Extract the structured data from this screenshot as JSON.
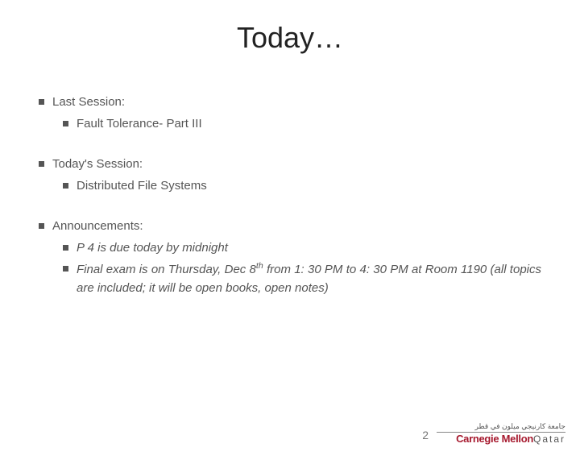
{
  "title": "Today…",
  "sections": [
    {
      "heading": "Last Session:",
      "items": [
        "Fault Tolerance- Part III"
      ]
    },
    {
      "heading": "Today's Session:",
      "items": [
        "Distributed File Systems"
      ]
    },
    {
      "heading": "Announcements:",
      "items": [
        "P 4 is due today by midnight",
        "Final exam is on Thursday, Dec 8th from 1: 30 PM to 4: 30 PM at Room 1190 (all topics are included; it will be open books, open notes)"
      ]
    }
  ],
  "page_number": "2",
  "logo": {
    "arabic": "جامعة كارنيجي ميلون في قطر",
    "line1": "Carnegie Mellon",
    "line2": "Qatar"
  }
}
